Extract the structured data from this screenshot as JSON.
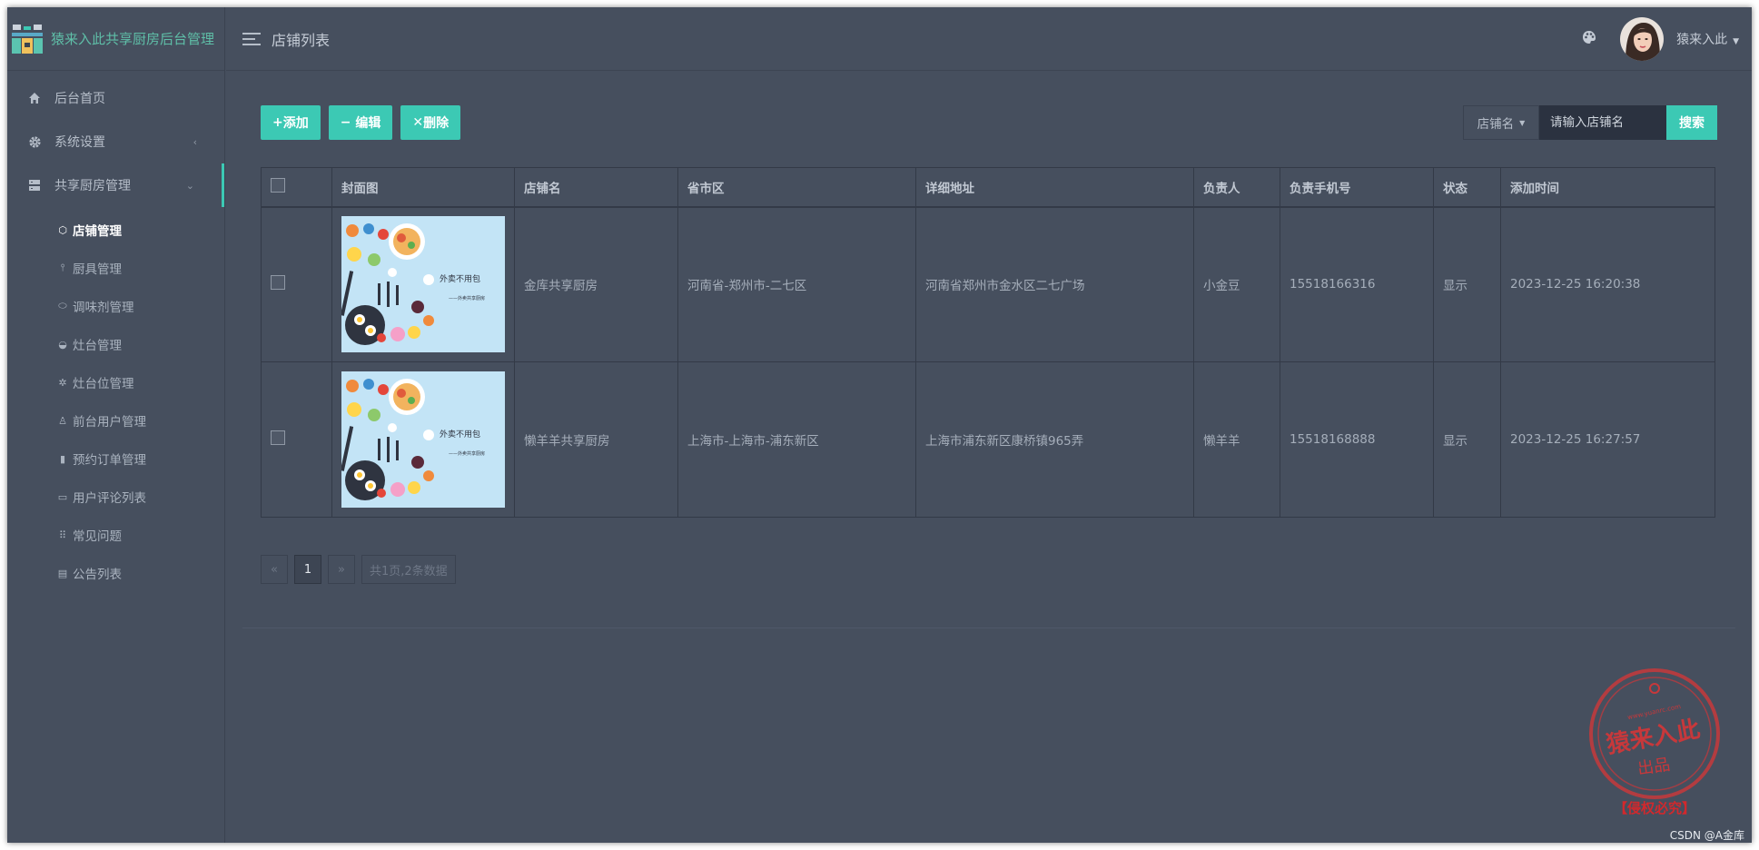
{
  "app": {
    "title": "猿来入此共享厨房后台管理"
  },
  "header": {
    "page_title": "店铺列表",
    "username": "猿来入此"
  },
  "sidebar": {
    "items": [
      {
        "label": "后台首页",
        "icon": "home-icon"
      },
      {
        "label": "系统设置",
        "icon": "gear-icon"
      },
      {
        "label": "共享厨房管理",
        "icon": "server-icon"
      }
    ],
    "submenu": [
      {
        "label": "店铺管理",
        "icon": "cube-icon",
        "active": true
      },
      {
        "label": "厨具管理",
        "icon": "tool-icon"
      },
      {
        "label": "调味剂管理",
        "icon": "pill-icon"
      },
      {
        "label": "灶台管理",
        "icon": "bowl-icon"
      },
      {
        "label": "灶台位管理",
        "icon": "gear-icon"
      },
      {
        "label": "前台用户管理",
        "icon": "user-icon"
      },
      {
        "label": "预约订单管理",
        "icon": "bookmark-icon"
      },
      {
        "label": "用户评论列表",
        "icon": "comment-icon"
      },
      {
        "label": "常见问题",
        "icon": "grid-icon"
      },
      {
        "label": "公告列表",
        "icon": "list-icon"
      }
    ]
  },
  "toolbar": {
    "add_label": "添加",
    "edit_label": "编辑",
    "delete_label": "删除"
  },
  "search": {
    "field_label": "店铺名",
    "placeholder": "请输入店铺名",
    "button_label": "搜索"
  },
  "table": {
    "columns": [
      "封面图",
      "店铺名",
      "省市区",
      "详细地址",
      "负责人",
      "负责手机号",
      "状态",
      "添加时间"
    ],
    "rows": [
      {
        "cover_caption": "外卖不用包",
        "cover_sub": "——外卖共享厨房",
        "name": "金库共享厨房",
        "region": "河南省-郑州市-二七区",
        "address": "河南省郑州市金水区二七广场",
        "manager": "小金豆",
        "phone": "15518166316",
        "status": "显示",
        "created": "2023-12-25 16:20:38"
      },
      {
        "cover_caption": "外卖不用包",
        "cover_sub": "——外卖共享厨房",
        "name": "懒羊羊共享厨房",
        "region": "上海市-上海市-浦东新区",
        "address": "上海市浦东新区康桥镇965弄",
        "manager": "懒羊羊",
        "phone": "15518168888",
        "status": "显示",
        "created": "2023-12-25 16:27:57"
      }
    ]
  },
  "pagination": {
    "prev": "«",
    "current": "1",
    "next": "»",
    "summary": "共1页,2条数据"
  },
  "watermark": {
    "url_text": "www.yuanrc.com",
    "main_text": "猿来入此",
    "sub_text": "出品",
    "footer_text": "【侵权必究】"
  },
  "credit": "CSDN @A金库",
  "colors": {
    "accent": "#3cc9b4",
    "background": "#464f5e",
    "status_green": "#2fbf83"
  }
}
